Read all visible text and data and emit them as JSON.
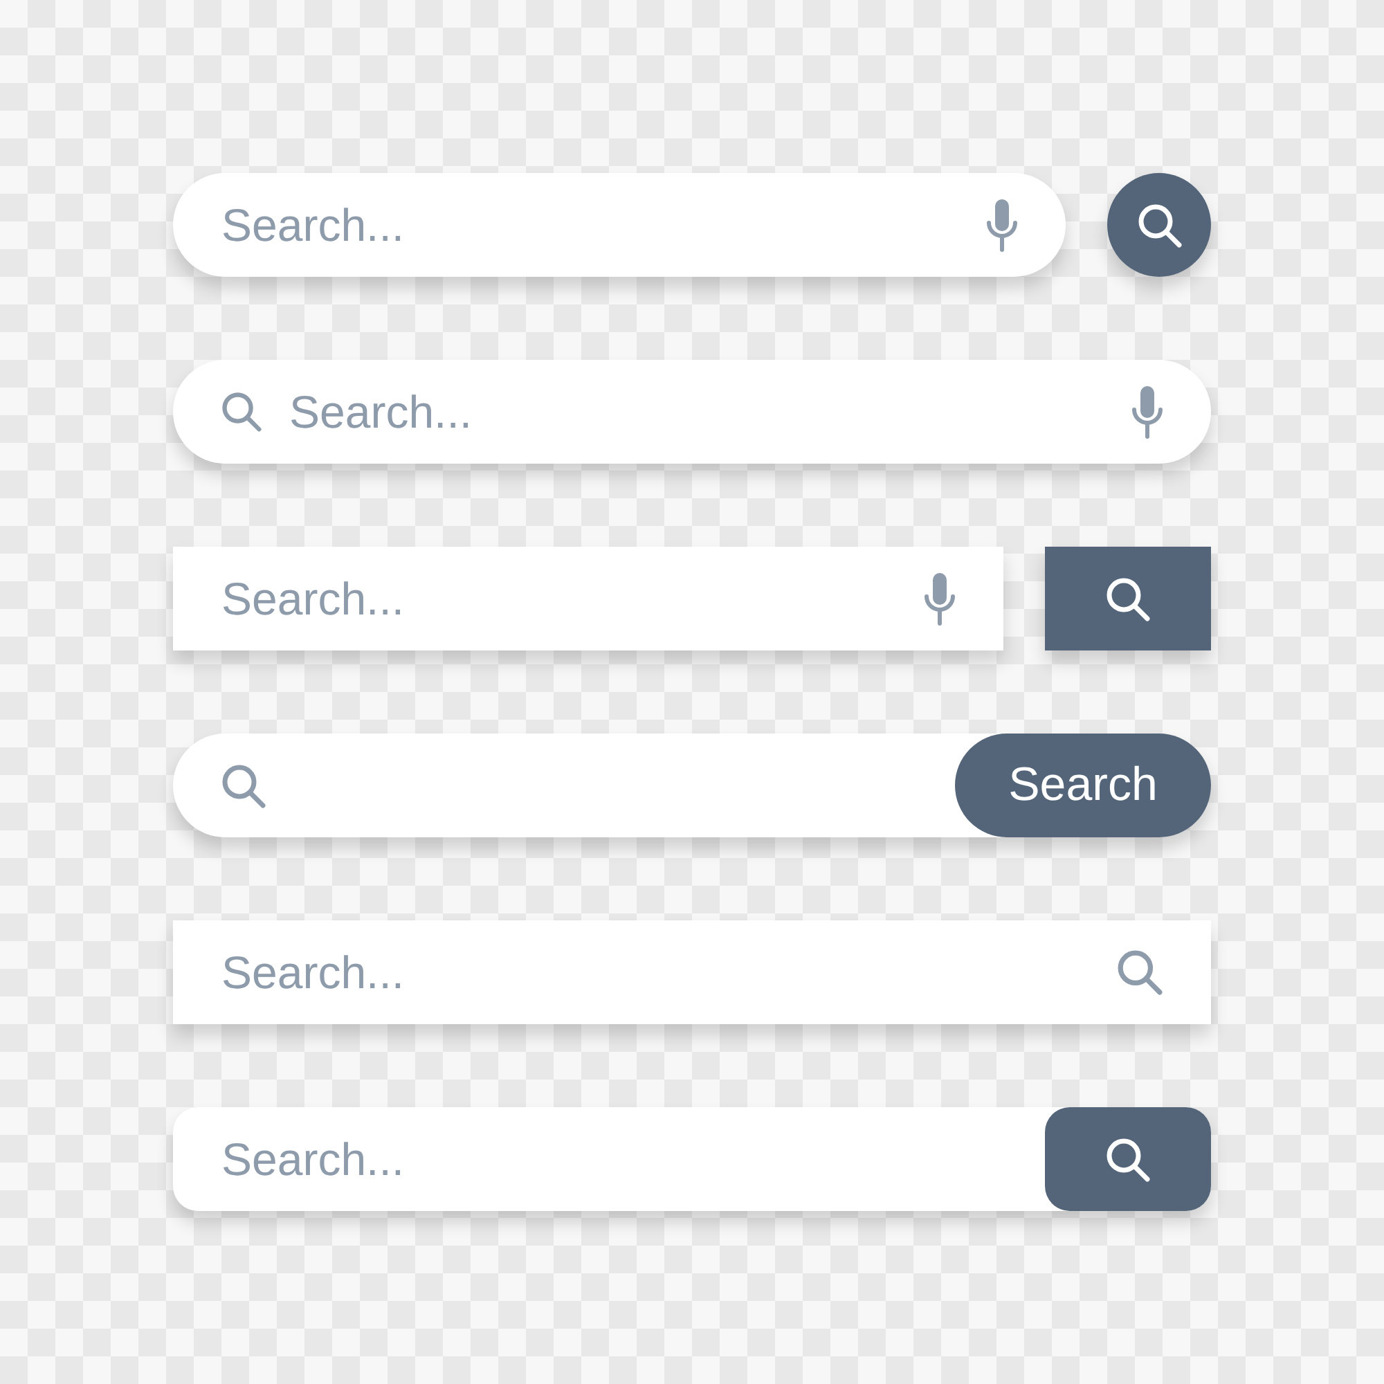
{
  "search_bars": [
    {
      "kind": "voice",
      "placeholder": "Search..."
    },
    {
      "kind": "leading",
      "placeholder": "Search..."
    },
    {
      "kind": "boxed",
      "placeholder": "Search..."
    },
    {
      "kind": "labeled",
      "button_label": "Search"
    },
    {
      "kind": "plain",
      "placeholder": "Search..."
    },
    {
      "kind": "attached",
      "placeholder": "Search..."
    }
  ]
}
